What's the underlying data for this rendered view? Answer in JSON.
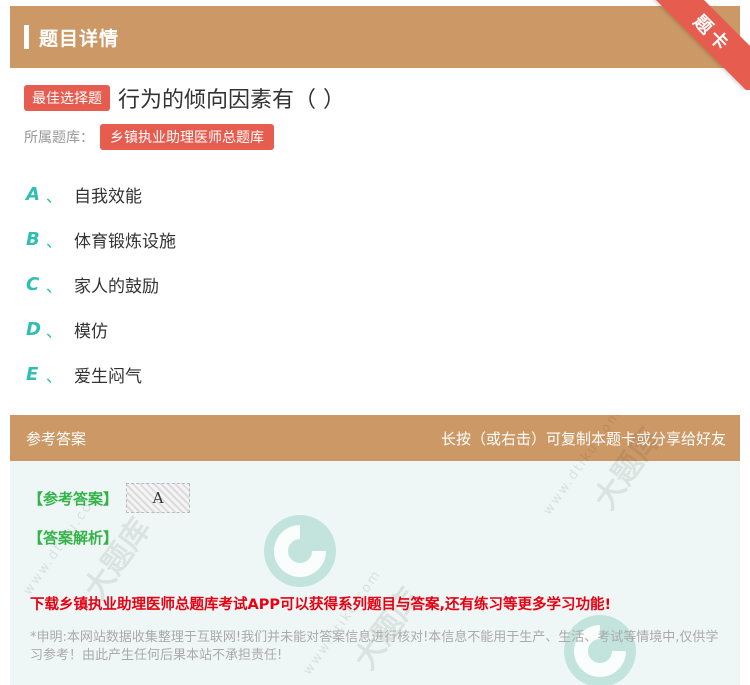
{
  "header": {
    "title": "题目详情",
    "ribbon": "题卡"
  },
  "question": {
    "type_badge": "最佳选择题",
    "text": "行为的倾向因素有（ ）",
    "bank_label": "所属题库：",
    "bank_name": "乡镇执业助理医师总题库"
  },
  "options": [
    {
      "letter": "A",
      "sep": "、",
      "text": "自我效能"
    },
    {
      "letter": "B",
      "sep": "、",
      "text": "体育锻炼设施"
    },
    {
      "letter": "C",
      "sep": "、",
      "text": "家人的鼓励"
    },
    {
      "letter": "D",
      "sep": "、",
      "text": "模仿"
    },
    {
      "letter": "E",
      "sep": "、",
      "text": "爱生闷气"
    }
  ],
  "answer_card": {
    "title": "参考答案",
    "hint": "长按（或右击）可复制本题卡或分享给好友",
    "answer_label": "【参考答案】",
    "answer_value": "A",
    "analysis_label": "【答案解析】",
    "promo": "下载乡镇执业助理医师总题库考试APP可以获得系列题目与答案,还有练习等更多学习功能!",
    "disclaimer": "*申明:本网站数据收集整理于互联网!我们并未能对答案信息进行核对!本信息不能用于生产、生活、考试等情境中,仅供学习参考！由此产生任何后果本站不承担责任!"
  },
  "watermark": {
    "brand": "大题库",
    "url": "www.dtiku.com"
  }
}
